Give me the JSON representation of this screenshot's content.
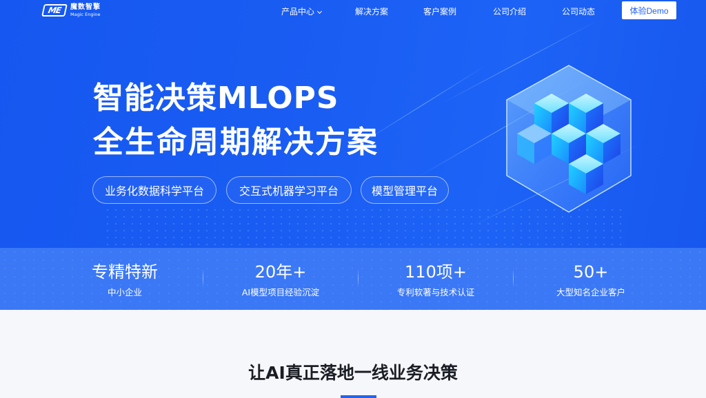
{
  "nav": {
    "logo": {
      "cn": "魔数智擎",
      "en": "Magic Engine",
      "mark": "ME",
      "icon": "magic-engine-logo"
    },
    "items": [
      {
        "label": "产品中心",
        "has_dropdown": true
      },
      {
        "label": "解决方案"
      },
      {
        "label": "客户案例"
      },
      {
        "label": "公司介绍"
      },
      {
        "label": "公司动态"
      }
    ],
    "demo_button": "体验Demo"
  },
  "hero": {
    "title_line1": "智能决策MLOPS",
    "title_line2": "全生命周期解决方案",
    "pills": [
      "业务化数据科学平台",
      "交互式机器学习平台",
      "模型管理平台"
    ],
    "illustration": "glass-cube-stack"
  },
  "stats": [
    {
      "value": "专精特新",
      "label": "中小企业"
    },
    {
      "value": "20年+",
      "label": "AI模型项目经验沉淀"
    },
    {
      "value": "110项+",
      "label": "专利软著与技术认证"
    },
    {
      "value": "50+",
      "label": "大型知名企业客户"
    }
  ],
  "section": {
    "title": "让AI真正落地一线业务决策"
  },
  "colors": {
    "hero_blue": "#1a5df3",
    "stats_blue": "#3b78f6",
    "accent": "#2463eb",
    "section_bg": "#f5f7fb"
  }
}
